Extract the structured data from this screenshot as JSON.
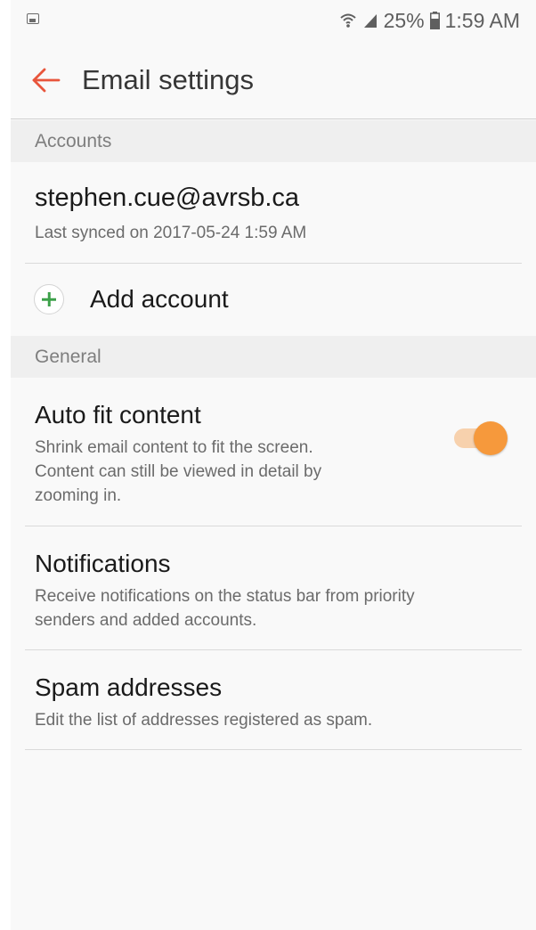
{
  "status_bar": {
    "battery_percent": "25%",
    "time": "1:59 AM",
    "left_icon": "gallery-notification-icon",
    "icons": [
      "wifi-icon",
      "signal-icon",
      "battery-icon"
    ]
  },
  "header": {
    "title": "Email settings",
    "back_icon": "arrow-left-icon",
    "accent_color": "#e8553c"
  },
  "accounts_section": {
    "header": "Accounts",
    "account": {
      "email": "stephen.cue@avrsb.ca",
      "last_synced": "Last synced on 2017-05-24  1:59 AM"
    },
    "add_account": {
      "label": "Add account",
      "icon": "plus-circle-icon",
      "icon_color": "#3da14a"
    }
  },
  "general_section": {
    "header": "General",
    "auto_fit": {
      "title": "Auto fit content",
      "description_line1": "Shrink email content to fit the screen.",
      "description_line2": "Content can still be viewed in detail by",
      "description_line3": "zooming in.",
      "enabled": true,
      "toggle_color": "#f6993c"
    },
    "notifications": {
      "title": "Notifications",
      "description_line1": "Receive notifications on the status bar from priority",
      "description_line2": "senders and added accounts."
    },
    "spam": {
      "title": "Spam addresses",
      "description": "Edit the list of addresses registered as spam."
    }
  }
}
